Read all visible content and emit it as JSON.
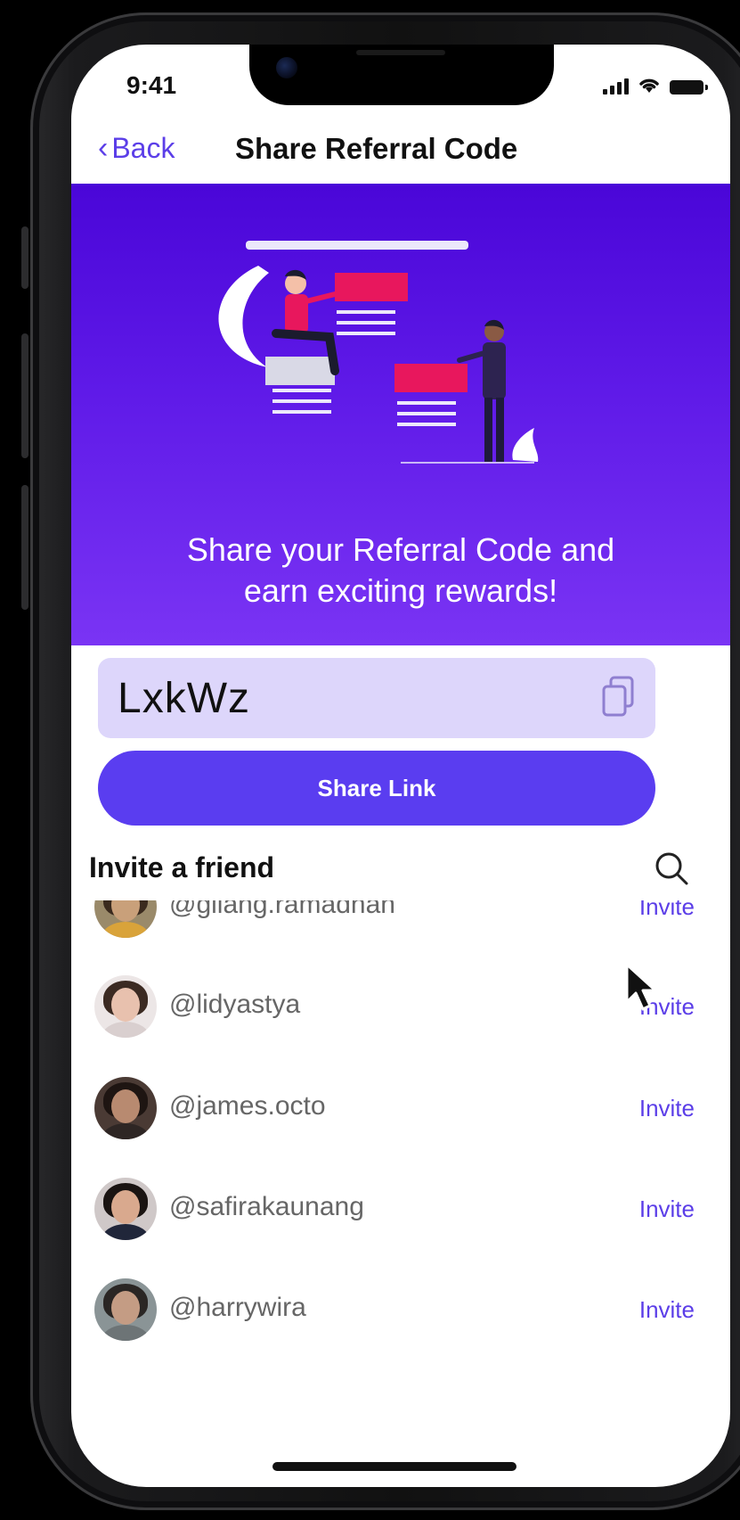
{
  "status_bar": {
    "time": "9:41"
  },
  "nav": {
    "back_label": "Back",
    "title": "Share Referral Code"
  },
  "hero": {
    "headline_line1": "Share your Referral Code and",
    "headline_line2": "earn exciting rewards!"
  },
  "referral": {
    "code": "LxkWz",
    "share_label": "Share Link"
  },
  "invite": {
    "title": "Invite a friend",
    "friends": [
      {
        "username": "@gilang.ramadhan",
        "action": "Invite"
      },
      {
        "username": "@lidyastya",
        "action": "Invite"
      },
      {
        "username": "@james.octo",
        "action": "Invite"
      },
      {
        "username": "@safirakaunang",
        "action": "Invite"
      },
      {
        "username": "@harrywira",
        "action": "Invite"
      }
    ]
  },
  "colors": {
    "accent": "#5a3df0",
    "hero_top": "#4a06d8",
    "hero_bottom": "#7a34f4",
    "code_bg": "#ddd6fb",
    "illustration_pink": "#e8175d"
  },
  "icons": [
    "chevron-left-icon",
    "copy-icon",
    "search-icon",
    "signal-icon",
    "wifi-icon",
    "battery-icon"
  ]
}
